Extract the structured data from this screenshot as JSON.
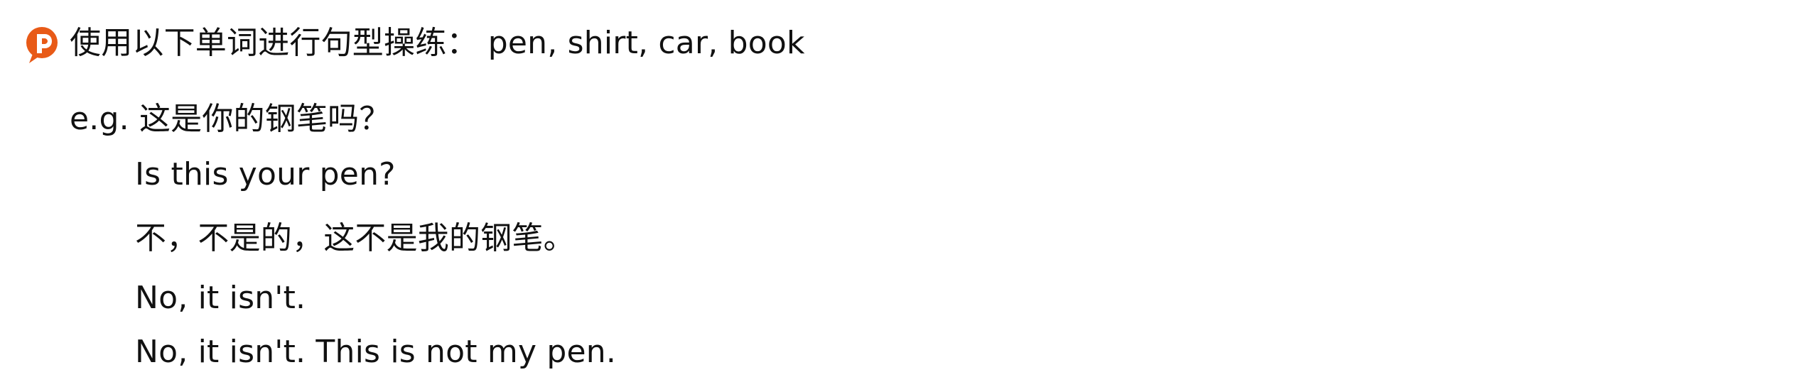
{
  "icons": {
    "prompt": "p-speech-bubble-icon",
    "prompt_color": "#e85a17"
  },
  "prompt": {
    "text": "使用以下单词进行句型操练： pen, shirt, car, book"
  },
  "example": {
    "label": "e.g. 这是你的钢笔吗？",
    "lines": [
      "Is this your pen?",
      "不，不是的，这不是我的钢笔。",
      "No, it isn't.",
      "No, it isn't. This is not my pen."
    ]
  }
}
